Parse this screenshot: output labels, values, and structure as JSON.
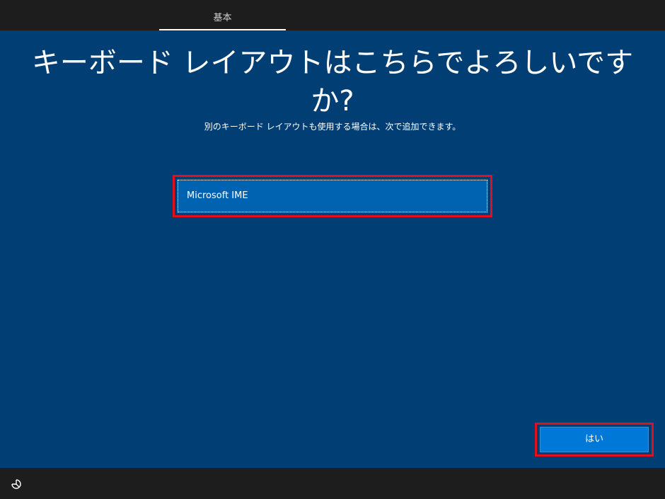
{
  "header": {
    "tab_label": "基本"
  },
  "main": {
    "title": "キーボード レイアウトはこちらでよろしいですか?",
    "subtitle": "別のキーボード レイアウトも使用する場合は、次で追加できます。",
    "layouts": [
      {
        "label": "Microsoft IME",
        "selected": true
      }
    ]
  },
  "footer": {
    "yes_button_label": "はい",
    "ease_of_access_icon": "ease-of-access-icon"
  },
  "colors": {
    "background": "#003e73",
    "bars": "#1c1d1c",
    "selected_item": "#0063b1",
    "button": "#0078d7",
    "highlight_frame": "#e0101d"
  }
}
